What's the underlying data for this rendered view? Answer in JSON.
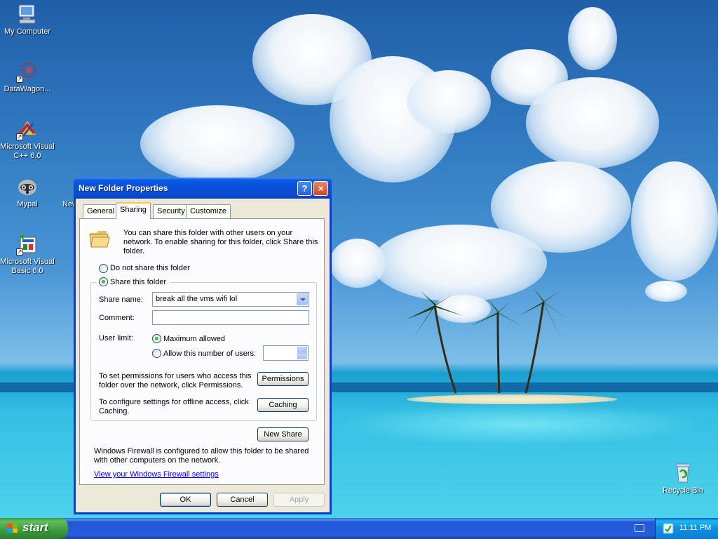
{
  "desktop": {
    "icons": [
      {
        "label": "My Computer"
      },
      {
        "label": "DataWagon..."
      },
      {
        "label": "Microsoft Visual C++ 6.0"
      },
      {
        "label": "Mypal"
      },
      {
        "label": "New"
      },
      {
        "label": "Microsoft Visual Basic 6.0"
      },
      {
        "label": "Recycle Bin"
      }
    ]
  },
  "dialog": {
    "title": "New Folder Properties",
    "help_label": "?",
    "close_label": "×",
    "tabs": [
      {
        "label": "General"
      },
      {
        "label": "Sharing"
      },
      {
        "label": "Security"
      },
      {
        "label": "Customize"
      }
    ],
    "sharing": {
      "intro_text": "You can share this folder with other users on your network.  To enable sharing for this folder, click Share this folder.",
      "do_not_share_label": "Do not share this folder",
      "share_this_label": "Share this folder",
      "share_name_label": "Share name:",
      "share_name_value": "break all the vms wifi lol",
      "comment_label": "Comment:",
      "comment_value": "",
      "user_limit_label": "User limit:",
      "maximum_allowed_label": "Maximum allowed",
      "allow_number_label": "Allow this number of users:",
      "allow_number_value": "",
      "permissions_text": "To set permissions for users who access this folder over the network, click Permissions.",
      "permissions_button": "Permissions",
      "caching_text": "To configure settings for offline access, click Caching.",
      "caching_button": "Caching",
      "new_share_button": "New Share",
      "firewall_text": "Windows Firewall is configured to allow this folder to be shared with other computers on the network.",
      "firewall_link": "View your Windows Firewall settings"
    },
    "buttons": {
      "ok": "OK",
      "cancel": "Cancel",
      "apply": "Apply"
    }
  },
  "taskbar": {
    "start_label": "start",
    "clock": "11:11 PM"
  }
}
